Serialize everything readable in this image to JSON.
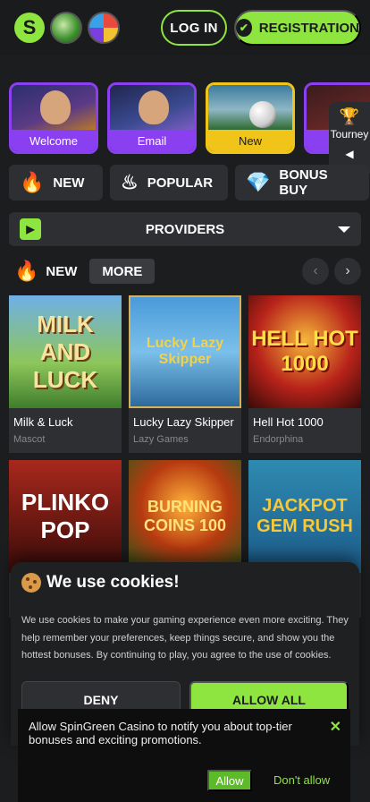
{
  "header": {
    "login_label": "LOG IN",
    "registration_label": "REGISTRATION"
  },
  "promos": [
    {
      "label": "Welcome"
    },
    {
      "label": "Email"
    },
    {
      "label": "New"
    },
    {
      "label": ""
    }
  ],
  "tourney": {
    "label": "Tourney"
  },
  "categories": [
    {
      "label": "NEW",
      "icon": "flame-icon"
    },
    {
      "label": "POPULAR",
      "icon": "fire-swirl-icon"
    },
    {
      "label": "BONUS BUY",
      "icon": "diamond-icon"
    }
  ],
  "providers": {
    "label": "PROVIDERS"
  },
  "section": {
    "title": "NEW",
    "more_label": "MORE"
  },
  "games": [
    {
      "name": "Milk & Luck",
      "provider": "Mascot",
      "art_text": "MILK AND LUCK"
    },
    {
      "name": "Lucky Lazy Skipper",
      "provider": "Lazy Games",
      "art_text": "Lucky Lazy Skipper"
    },
    {
      "name": "Hell Hot 1000",
      "provider": "Endorphina",
      "art_text": "HELL HOT 1000"
    },
    {
      "name": "",
      "provider": "",
      "art_text": "PLINKO POP"
    },
    {
      "name": "",
      "provider": "",
      "art_text": "BURNING COINS 100"
    },
    {
      "name": "",
      "provider": "",
      "art_text": "JACKPOT GEM RUSH"
    }
  ],
  "cookie": {
    "title": "We use cookies!",
    "text": "We use cookies to make your gaming experience even more exciting. They help remember your preferences, keep things secure, and show you the hottest bonuses. By continuing to play, you agree to the use of cookies.",
    "deny_label": "DENY",
    "allow_label": "ALLOW ALL"
  },
  "notification": {
    "text": "Allow SpinGreen Casino to notify you about top-tier bonuses and exciting promotions.",
    "allow_label": "Allow",
    "deny_label": "Don't allow"
  },
  "colors": {
    "accent": "#8ee53f",
    "promo_purple": "#8a3ff0",
    "promo_yellow": "#f0c419",
    "background": "#1c1d1f"
  }
}
